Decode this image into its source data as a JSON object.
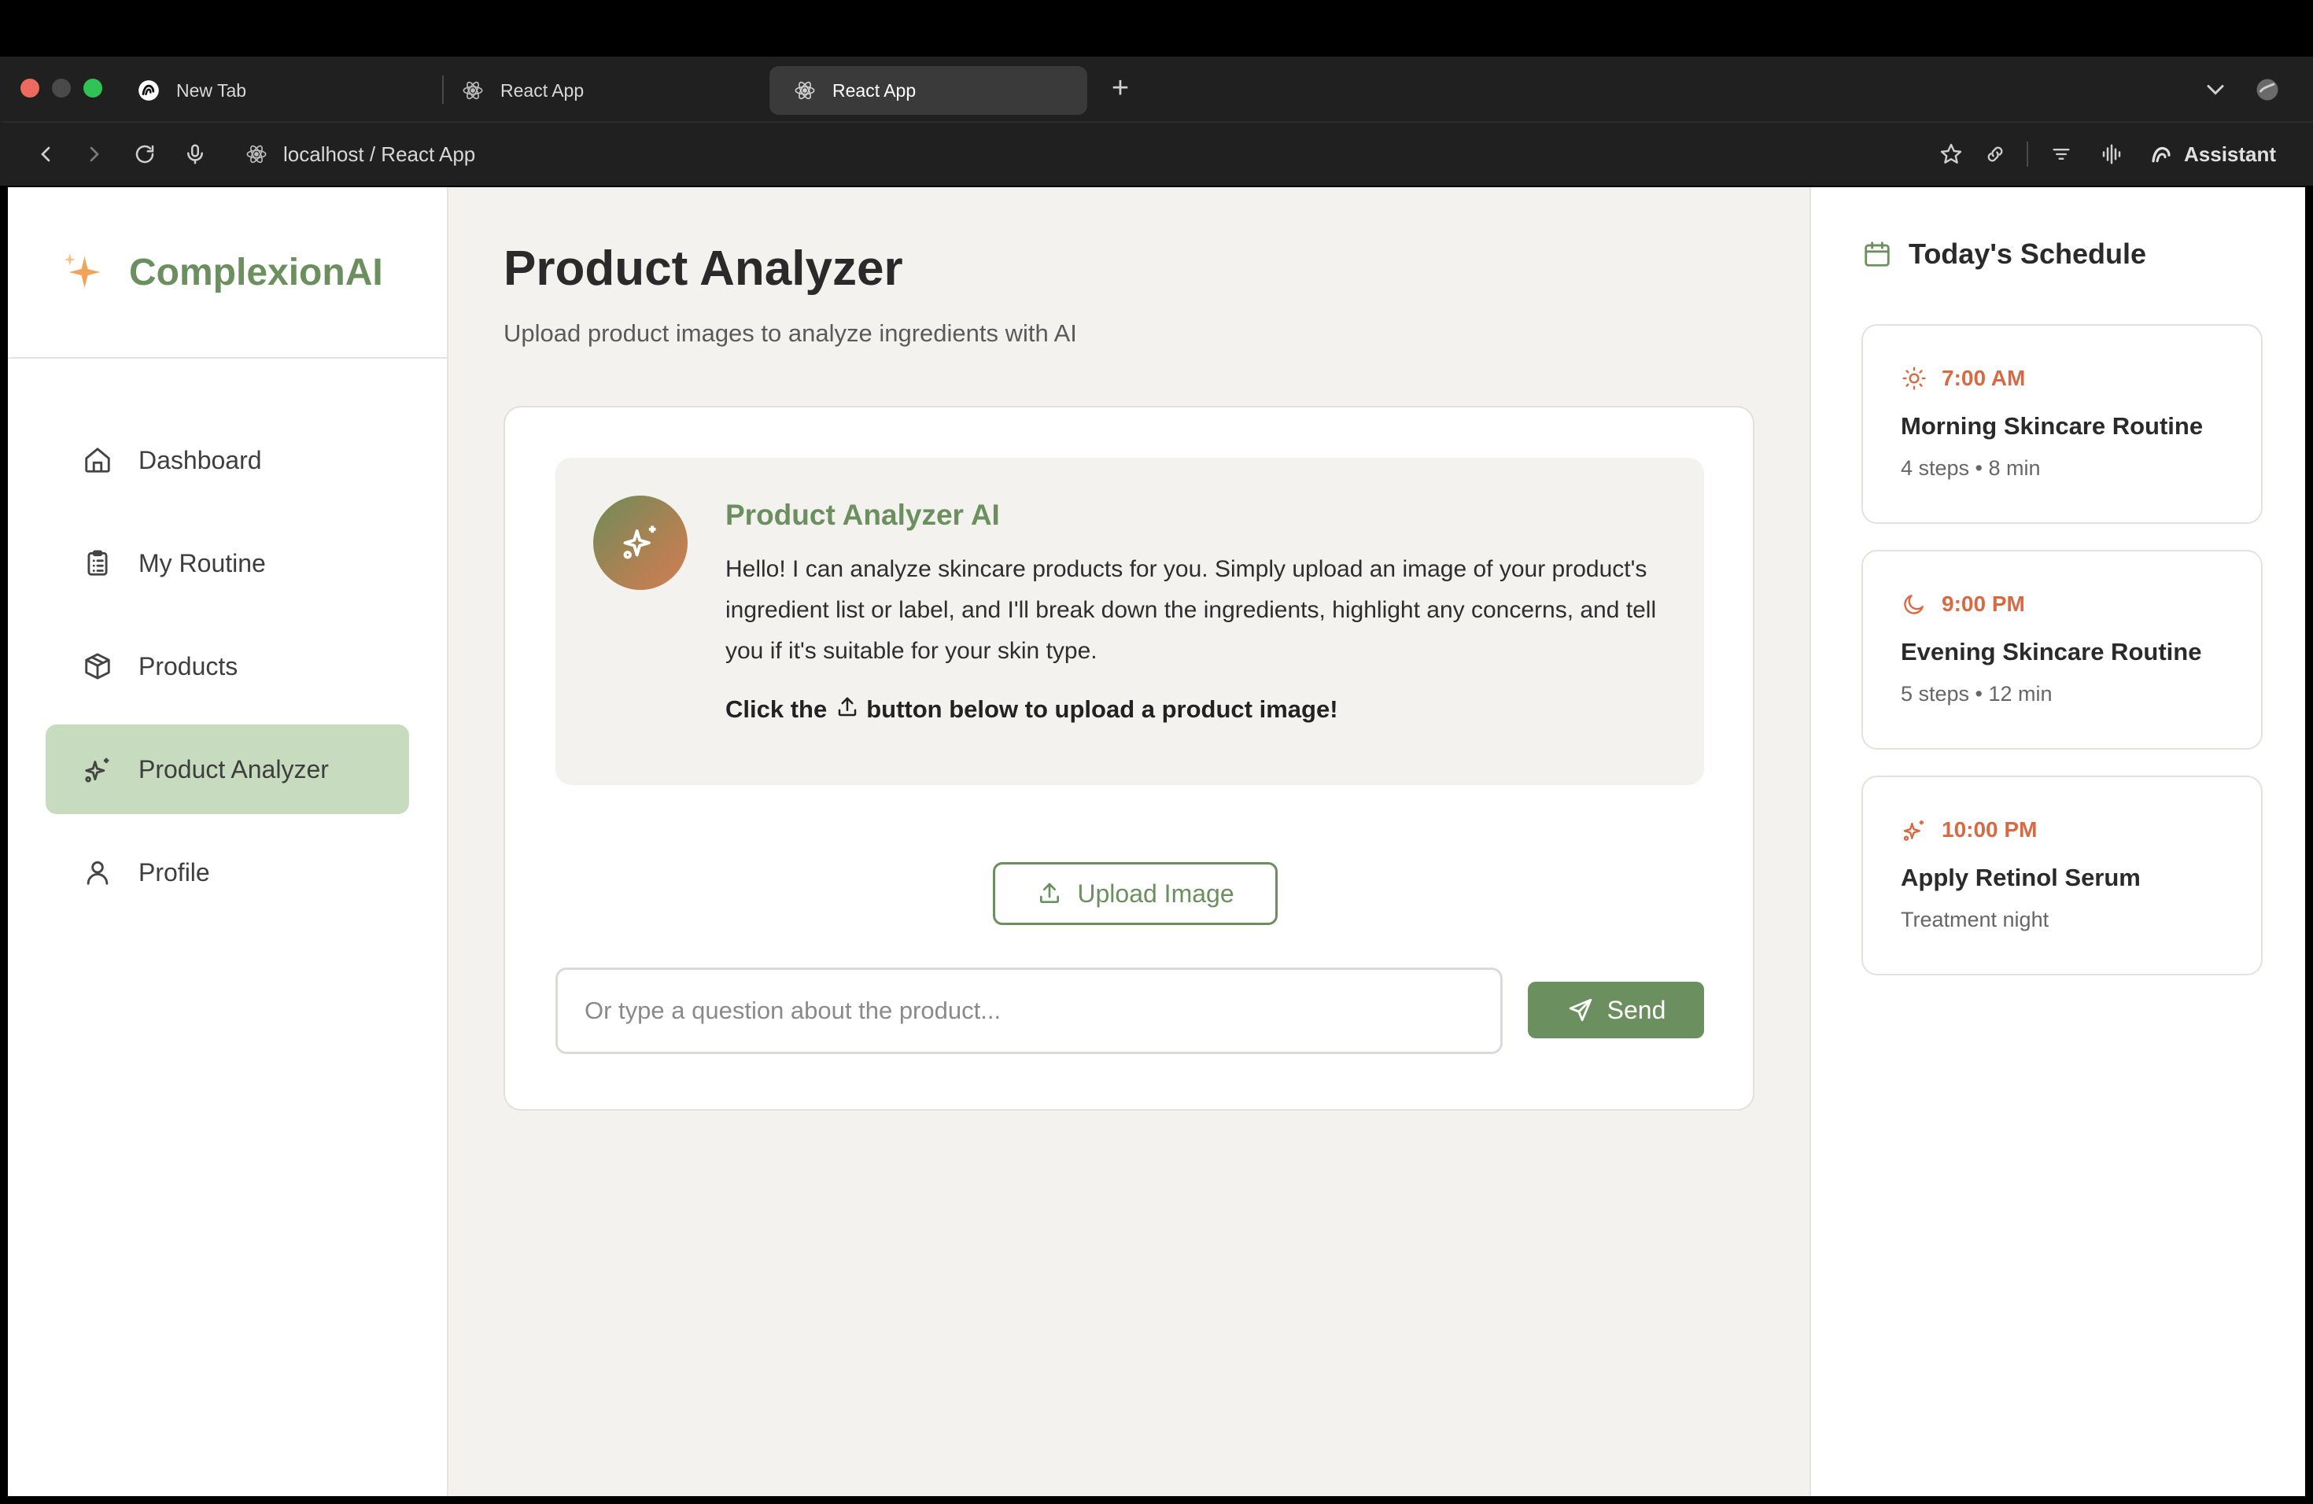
{
  "browser": {
    "tabs": [
      {
        "title": "New Tab",
        "icon": "arc-icon",
        "active": false
      },
      {
        "title": "React App",
        "icon": "react-icon",
        "active": false
      },
      {
        "title": "React App",
        "icon": "react-icon",
        "active": true
      }
    ],
    "url": "localhost / React App",
    "assistant_label": "Assistant"
  },
  "sidebar": {
    "brand": "ComplexionAI",
    "items": [
      {
        "label": "Dashboard",
        "icon": "home-icon",
        "active": false
      },
      {
        "label": "My Routine",
        "icon": "clipboard-list-icon",
        "active": false
      },
      {
        "label": "Products",
        "icon": "package-icon",
        "active": false
      },
      {
        "label": "Product Analyzer",
        "icon": "sparkles-icon",
        "active": true
      },
      {
        "label": "Profile",
        "icon": "user-icon",
        "active": false
      }
    ]
  },
  "main": {
    "title": "Product Analyzer",
    "subtitle": "Upload product images to analyze ingredients with AI",
    "assistant": {
      "name": "Product Analyzer AI",
      "message": "Hello! I can analyze skincare products for you. Simply upload an image of your product's ingredient list or label, and I'll break down the ingredients, highlight any concerns, and tell you if it's suitable for your skin type.",
      "cta_before": "Click the",
      "cta_after": "button below to upload a product image!"
    },
    "upload_label": "Upload Image",
    "input_placeholder": "Or type a question about the product...",
    "send_label": "Send"
  },
  "schedule": {
    "title": "Today's Schedule",
    "events": [
      {
        "time": "7:00 AM",
        "icon": "sun-icon",
        "title": "Morning Skincare Routine",
        "meta": "4 steps • 8 min"
      },
      {
        "time": "9:00 PM",
        "icon": "moon-icon",
        "title": "Evening Skincare Routine",
        "meta": "5 steps • 12 min"
      },
      {
        "time": "10:00 PM",
        "icon": "sparkles-icon",
        "title": "Apply Retinol Serum",
        "meta": "Treatment night"
      }
    ]
  },
  "colors": {
    "brand_green": "#6b8f5e",
    "active_nav_bg": "#c7dcbe",
    "accent_orange": "#d86a43",
    "app_background": "#f3f2ee"
  }
}
